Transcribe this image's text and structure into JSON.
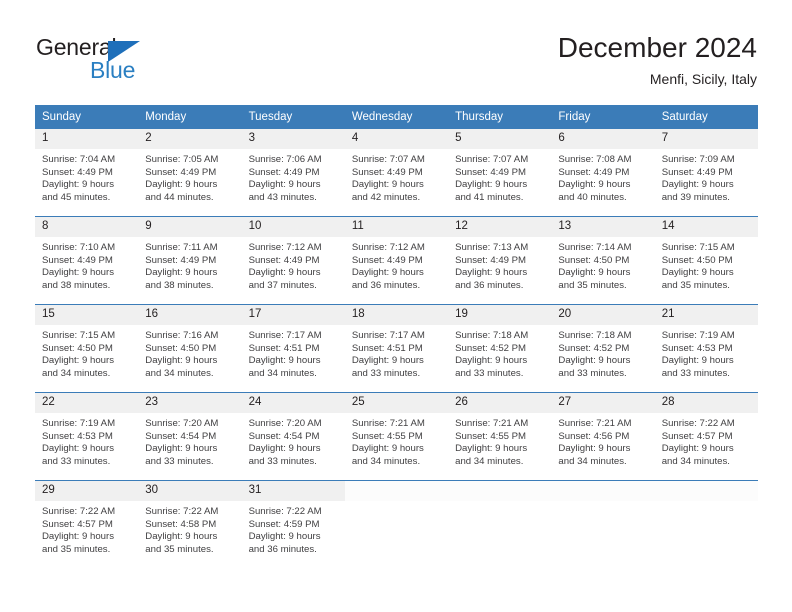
{
  "brand": {
    "name_part1": "General",
    "name_part2": "Blue",
    "triangle_color": "#1e6fba",
    "blue_color": "#2a7fc2"
  },
  "header": {
    "title": "December 2024",
    "location": "Menfi, Sicily, Italy"
  },
  "theme": {
    "header_blue": "#3b7cb8",
    "daynum_band": "#f0f0f0",
    "text": "#231f20",
    "info_text": "#414042"
  },
  "calendar": {
    "weekday_headers": [
      "Sunday",
      "Monday",
      "Tuesday",
      "Wednesday",
      "Thursday",
      "Friday",
      "Saturday"
    ],
    "weeks": [
      [
        {
          "day": "1",
          "sunrise": "Sunrise: 7:04 AM",
          "sunset": "Sunset: 4:49 PM",
          "daylight_line1": "Daylight: 9 hours",
          "daylight_line2": "and 45 minutes."
        },
        {
          "day": "2",
          "sunrise": "Sunrise: 7:05 AM",
          "sunset": "Sunset: 4:49 PM",
          "daylight_line1": "Daylight: 9 hours",
          "daylight_line2": "and 44 minutes."
        },
        {
          "day": "3",
          "sunrise": "Sunrise: 7:06 AM",
          "sunset": "Sunset: 4:49 PM",
          "daylight_line1": "Daylight: 9 hours",
          "daylight_line2": "and 43 minutes."
        },
        {
          "day": "4",
          "sunrise": "Sunrise: 7:07 AM",
          "sunset": "Sunset: 4:49 PM",
          "daylight_line1": "Daylight: 9 hours",
          "daylight_line2": "and 42 minutes."
        },
        {
          "day": "5",
          "sunrise": "Sunrise: 7:07 AM",
          "sunset": "Sunset: 4:49 PM",
          "daylight_line1": "Daylight: 9 hours",
          "daylight_line2": "and 41 minutes."
        },
        {
          "day": "6",
          "sunrise": "Sunrise: 7:08 AM",
          "sunset": "Sunset: 4:49 PM",
          "daylight_line1": "Daylight: 9 hours",
          "daylight_line2": "and 40 minutes."
        },
        {
          "day": "7",
          "sunrise": "Sunrise: 7:09 AM",
          "sunset": "Sunset: 4:49 PM",
          "daylight_line1": "Daylight: 9 hours",
          "daylight_line2": "and 39 minutes."
        }
      ],
      [
        {
          "day": "8",
          "sunrise": "Sunrise: 7:10 AM",
          "sunset": "Sunset: 4:49 PM",
          "daylight_line1": "Daylight: 9 hours",
          "daylight_line2": "and 38 minutes."
        },
        {
          "day": "9",
          "sunrise": "Sunrise: 7:11 AM",
          "sunset": "Sunset: 4:49 PM",
          "daylight_line1": "Daylight: 9 hours",
          "daylight_line2": "and 38 minutes."
        },
        {
          "day": "10",
          "sunrise": "Sunrise: 7:12 AM",
          "sunset": "Sunset: 4:49 PM",
          "daylight_line1": "Daylight: 9 hours",
          "daylight_line2": "and 37 minutes."
        },
        {
          "day": "11",
          "sunrise": "Sunrise: 7:12 AM",
          "sunset": "Sunset: 4:49 PM",
          "daylight_line1": "Daylight: 9 hours",
          "daylight_line2": "and 36 minutes."
        },
        {
          "day": "12",
          "sunrise": "Sunrise: 7:13 AM",
          "sunset": "Sunset: 4:49 PM",
          "daylight_line1": "Daylight: 9 hours",
          "daylight_line2": "and 36 minutes."
        },
        {
          "day": "13",
          "sunrise": "Sunrise: 7:14 AM",
          "sunset": "Sunset: 4:50 PM",
          "daylight_line1": "Daylight: 9 hours",
          "daylight_line2": "and 35 minutes."
        },
        {
          "day": "14",
          "sunrise": "Sunrise: 7:15 AM",
          "sunset": "Sunset: 4:50 PM",
          "daylight_line1": "Daylight: 9 hours",
          "daylight_line2": "and 35 minutes."
        }
      ],
      [
        {
          "day": "15",
          "sunrise": "Sunrise: 7:15 AM",
          "sunset": "Sunset: 4:50 PM",
          "daylight_line1": "Daylight: 9 hours",
          "daylight_line2": "and 34 minutes."
        },
        {
          "day": "16",
          "sunrise": "Sunrise: 7:16 AM",
          "sunset": "Sunset: 4:50 PM",
          "daylight_line1": "Daylight: 9 hours",
          "daylight_line2": "and 34 minutes."
        },
        {
          "day": "17",
          "sunrise": "Sunrise: 7:17 AM",
          "sunset": "Sunset: 4:51 PM",
          "daylight_line1": "Daylight: 9 hours",
          "daylight_line2": "and 34 minutes."
        },
        {
          "day": "18",
          "sunrise": "Sunrise: 7:17 AM",
          "sunset": "Sunset: 4:51 PM",
          "daylight_line1": "Daylight: 9 hours",
          "daylight_line2": "and 33 minutes."
        },
        {
          "day": "19",
          "sunrise": "Sunrise: 7:18 AM",
          "sunset": "Sunset: 4:52 PM",
          "daylight_line1": "Daylight: 9 hours",
          "daylight_line2": "and 33 minutes."
        },
        {
          "day": "20",
          "sunrise": "Sunrise: 7:18 AM",
          "sunset": "Sunset: 4:52 PM",
          "daylight_line1": "Daylight: 9 hours",
          "daylight_line2": "and 33 minutes."
        },
        {
          "day": "21",
          "sunrise": "Sunrise: 7:19 AM",
          "sunset": "Sunset: 4:53 PM",
          "daylight_line1": "Daylight: 9 hours",
          "daylight_line2": "and 33 minutes."
        }
      ],
      [
        {
          "day": "22",
          "sunrise": "Sunrise: 7:19 AM",
          "sunset": "Sunset: 4:53 PM",
          "daylight_line1": "Daylight: 9 hours",
          "daylight_line2": "and 33 minutes."
        },
        {
          "day": "23",
          "sunrise": "Sunrise: 7:20 AM",
          "sunset": "Sunset: 4:54 PM",
          "daylight_line1": "Daylight: 9 hours",
          "daylight_line2": "and 33 minutes."
        },
        {
          "day": "24",
          "sunrise": "Sunrise: 7:20 AM",
          "sunset": "Sunset: 4:54 PM",
          "daylight_line1": "Daylight: 9 hours",
          "daylight_line2": "and 33 minutes."
        },
        {
          "day": "25",
          "sunrise": "Sunrise: 7:21 AM",
          "sunset": "Sunset: 4:55 PM",
          "daylight_line1": "Daylight: 9 hours",
          "daylight_line2": "and 34 minutes."
        },
        {
          "day": "26",
          "sunrise": "Sunrise: 7:21 AM",
          "sunset": "Sunset: 4:55 PM",
          "daylight_line1": "Daylight: 9 hours",
          "daylight_line2": "and 34 minutes."
        },
        {
          "day": "27",
          "sunrise": "Sunrise: 7:21 AM",
          "sunset": "Sunset: 4:56 PM",
          "daylight_line1": "Daylight: 9 hours",
          "daylight_line2": "and 34 minutes."
        },
        {
          "day": "28",
          "sunrise": "Sunrise: 7:22 AM",
          "sunset": "Sunset: 4:57 PM",
          "daylight_line1": "Daylight: 9 hours",
          "daylight_line2": "and 34 minutes."
        }
      ],
      [
        {
          "day": "29",
          "sunrise": "Sunrise: 7:22 AM",
          "sunset": "Sunset: 4:57 PM",
          "daylight_line1": "Daylight: 9 hours",
          "daylight_line2": "and 35 minutes."
        },
        {
          "day": "30",
          "sunrise": "Sunrise: 7:22 AM",
          "sunset": "Sunset: 4:58 PM",
          "daylight_line1": "Daylight: 9 hours",
          "daylight_line2": "and 35 minutes."
        },
        {
          "day": "31",
          "sunrise": "Sunrise: 7:22 AM",
          "sunset": "Sunset: 4:59 PM",
          "daylight_line1": "Daylight: 9 hours",
          "daylight_line2": "and 36 minutes."
        },
        {
          "day": "",
          "sunrise": "",
          "sunset": "",
          "daylight_line1": "",
          "daylight_line2": ""
        },
        {
          "day": "",
          "sunrise": "",
          "sunset": "",
          "daylight_line1": "",
          "daylight_line2": ""
        },
        {
          "day": "",
          "sunrise": "",
          "sunset": "",
          "daylight_line1": "",
          "daylight_line2": ""
        },
        {
          "day": "",
          "sunrise": "",
          "sunset": "",
          "daylight_line1": "",
          "daylight_line2": ""
        }
      ]
    ]
  }
}
